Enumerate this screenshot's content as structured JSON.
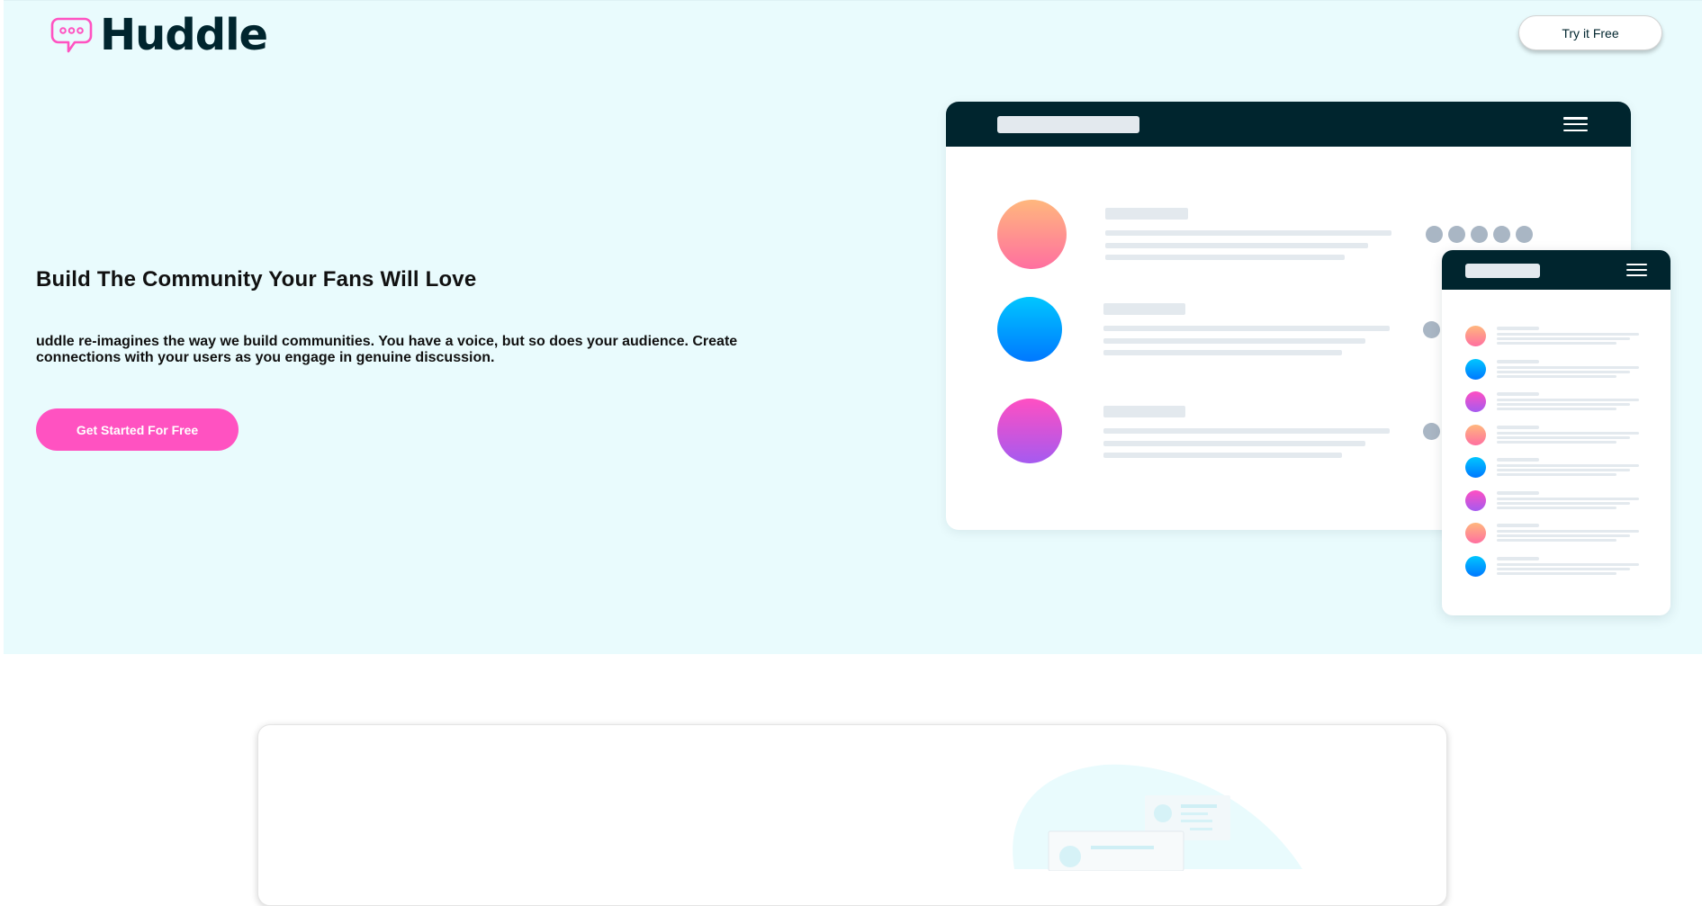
{
  "header": {
    "logo_text": "Huddle",
    "logo_icon": "chat-bubble-icon",
    "try_button_label": "Try it Free"
  },
  "hero": {
    "headline": "Build The Community Your Fans Will Love",
    "intro": "uddle re-imagines the way we build communities. You have a voice, but so does your audience. Create connections with your users as you engage in genuine discussion.",
    "cta_label": "Get Started For Free"
  },
  "colors": {
    "hero_background": "#e9fbfd",
    "brand_dark": "#00252e",
    "accent_pink": "#ff52c1",
    "placeholder_gray": "#e3e9ee",
    "dot_gray": "#a9b6c4"
  },
  "illustration": {
    "desktop_menu_icon": "hamburger-menu-icon",
    "phone_menu_icon": "hamburger-menu-icon",
    "avatar_gradients": [
      "orange",
      "blue",
      "purple"
    ],
    "phone_avatar_gradients": [
      "orange",
      "blue",
      "purple",
      "orange",
      "blue",
      "purple",
      "orange",
      "blue"
    ]
  },
  "features": {
    "illustration_icon": "community-illustration-icon"
  }
}
